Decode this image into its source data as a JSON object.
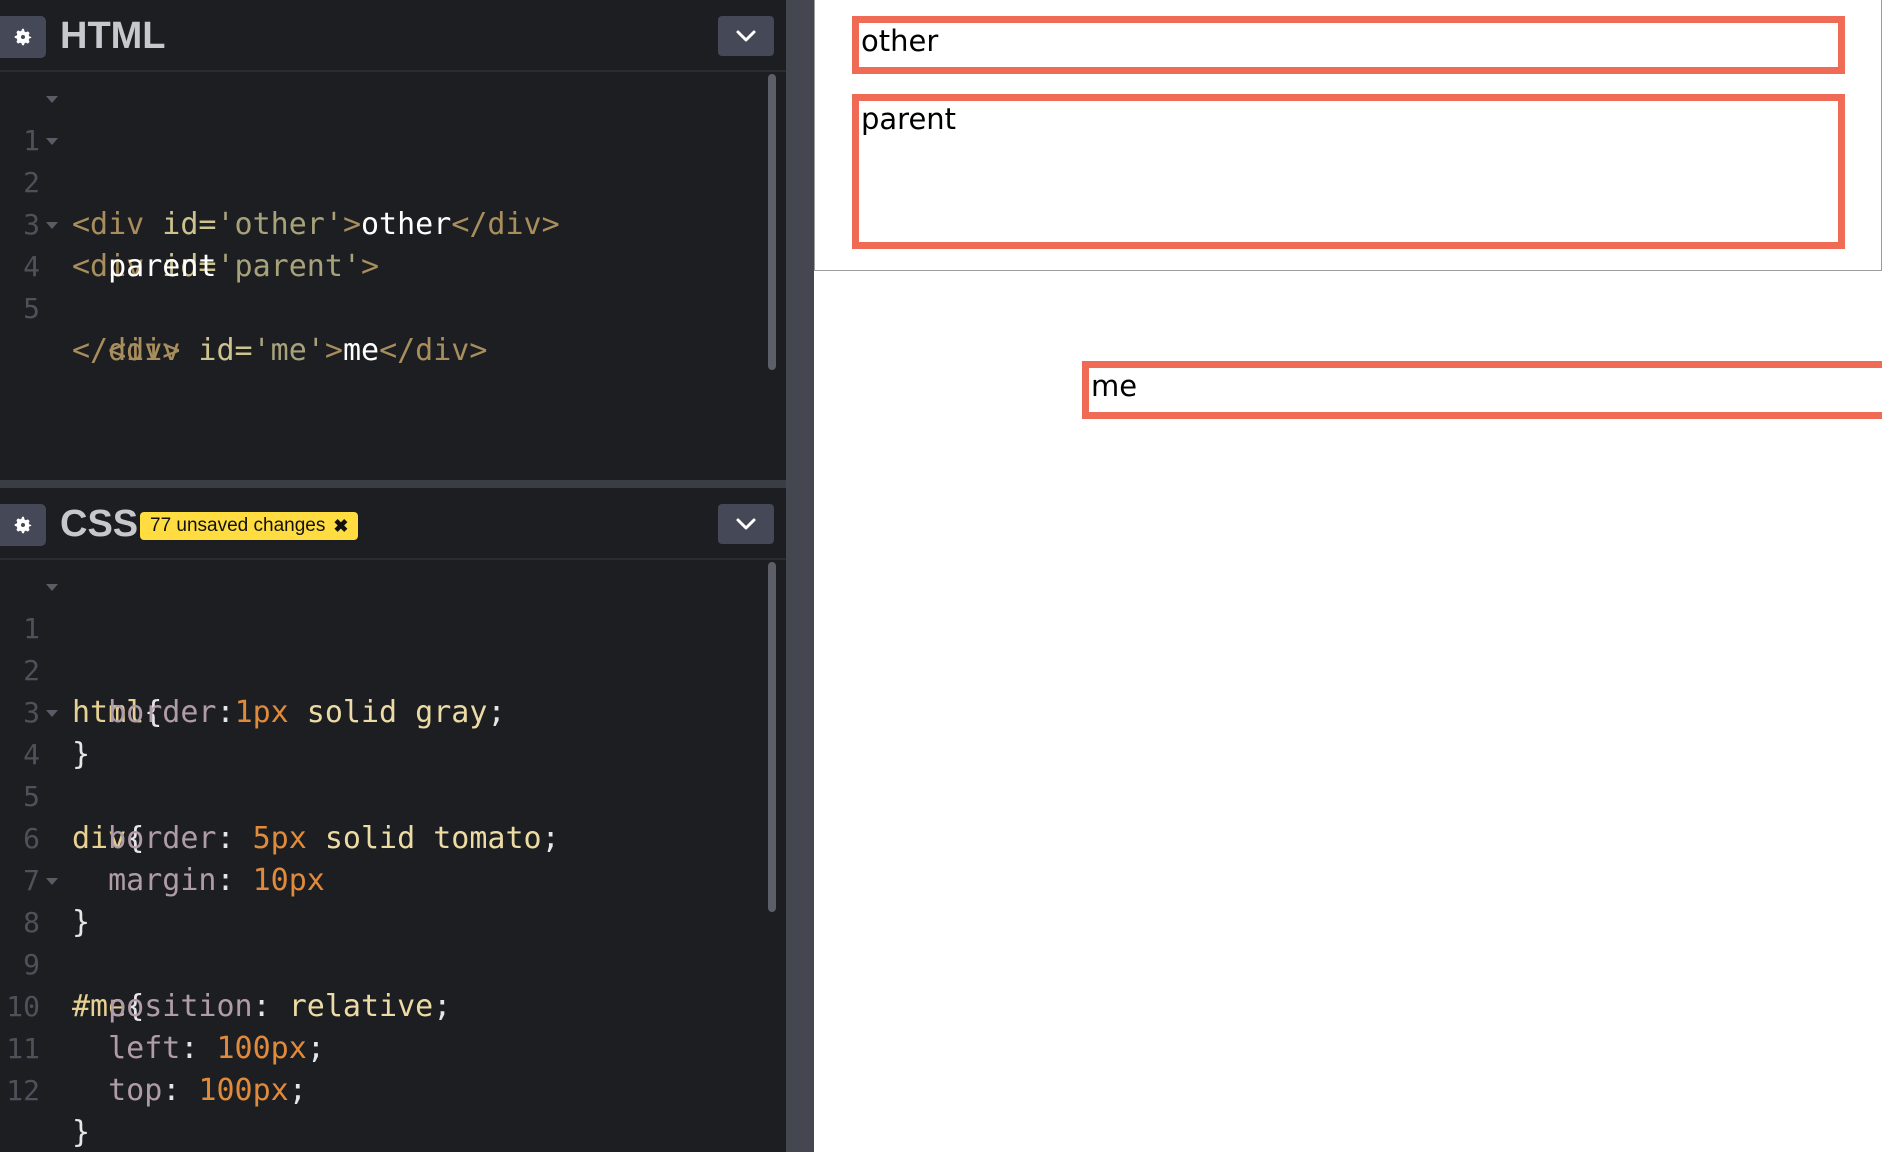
{
  "html_panel": {
    "title": "HTML",
    "lines": [
      {
        "n": "1",
        "fold": true
      },
      {
        "n": "2",
        "fold": true
      },
      {
        "n": "3",
        "fold": false
      },
      {
        "n": "4",
        "fold": true
      },
      {
        "n": "5",
        "fold": false
      }
    ],
    "code": {
      "l1": {
        "open": "<div",
        "attr": " id=",
        "val": "'other'",
        "close": ">",
        "text": "other",
        "end": "</div>"
      },
      "l2": {
        "open": "<div",
        "attr": " id=",
        "val": "'parent'",
        "close": ">"
      },
      "l3": {
        "text": "parent"
      },
      "l4": {
        "open": "<div",
        "attr": " id=",
        "val": "'me'",
        "close": ">",
        "text": "me",
        "end": "</div>"
      },
      "l5": {
        "end": "</div>"
      }
    }
  },
  "css_panel": {
    "title": "CSS",
    "badge": "77 unsaved changes",
    "badge_close": "✖",
    "lines": [
      "1",
      "2",
      "3",
      "4",
      "5",
      "6",
      "7",
      "8",
      "9",
      "10",
      "11",
      "12"
    ],
    "code": {
      "l1": {
        "sel": "html",
        "brace": "{"
      },
      "l2": {
        "prop": "border",
        "colon": ":",
        "num": "1px",
        "val": " solid gray",
        "semi": ";"
      },
      "l3": {
        "brace": "}"
      },
      "l4": {
        "sel": "div",
        "brace": "{"
      },
      "l5": {
        "prop": "border",
        "colon": ": ",
        "num": "5px",
        "val": " solid tomato",
        "semi": ";"
      },
      "l6": {
        "prop": "margin",
        "colon": ": ",
        "num": "10px"
      },
      "l7": {
        "brace": "}"
      },
      "l8": {
        "sel": "#me",
        "brace": "{"
      },
      "l9": {
        "prop": "position",
        "colon": ": ",
        "val": "relative",
        "semi": ";"
      },
      "l10": {
        "prop": "left",
        "colon": ": ",
        "num": "100px",
        "semi": ";"
      },
      "l11": {
        "prop": "top",
        "colon": ": ",
        "num": "100px",
        "semi": ";"
      },
      "l12": {
        "brace": "}"
      }
    }
  },
  "preview": {
    "other": "other",
    "parent": "parent",
    "me": "me"
  },
  "colors": {
    "editor_bg": "#1d1e22",
    "tomato": "#ef6b55",
    "badge": "#ffdd40"
  },
  "icons": {
    "settings": "gear-icon",
    "collapse": "chevron-down-icon",
    "fold": "fold-arrow-icon"
  }
}
